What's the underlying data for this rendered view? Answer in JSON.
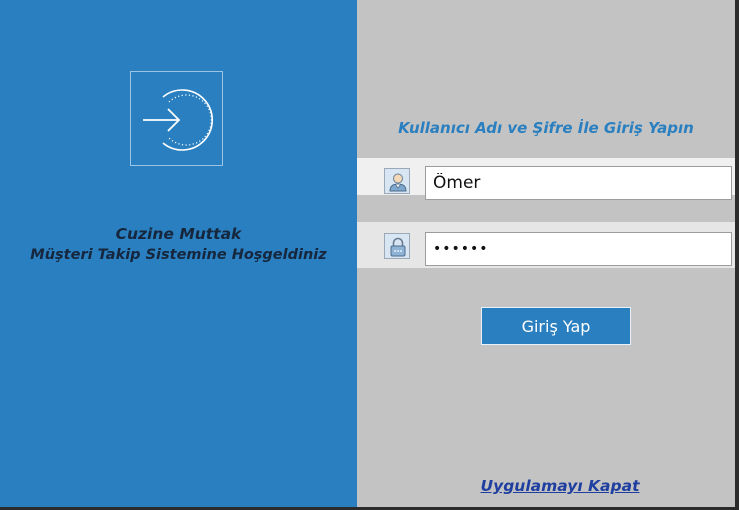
{
  "window": {
    "colors": {
      "left_panel": "#2a7fc0",
      "right_panel": "#c3c3c3",
      "accent": "#2a7fc0",
      "welcome_text": "#16263d",
      "link": "#1f3fa0"
    }
  },
  "left_panel": {
    "icon": "login-arrow-icon",
    "welcome_line1": "Cuzine Muttak",
    "welcome_line2": "Müşteri Takip Sistemine Hoşgeldiniz"
  },
  "login_form": {
    "subtitle": "Kullanıcı Adı ve Şifre İle Giriş Yapın",
    "username": {
      "icon": "user-icon",
      "value": "Ömer"
    },
    "password": {
      "icon": "lock-icon",
      "value": "••••••"
    },
    "login_button_label": "Giriş Yap",
    "close_link_label": "Uygulamayı Kapat"
  }
}
